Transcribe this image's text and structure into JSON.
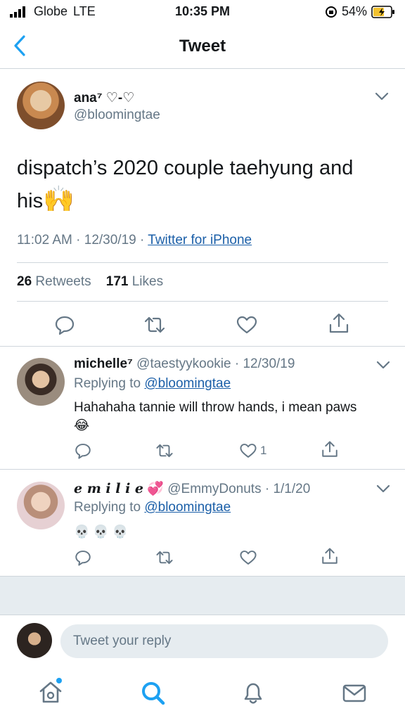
{
  "status_bar": {
    "carrier": "Globe",
    "network": "LTE",
    "time": "10:35 PM",
    "battery": "54%"
  },
  "header": {
    "title": "Tweet",
    "back_icon": "chevron-left-icon"
  },
  "tweet": {
    "display_name": "ana⁷ ♡-♡",
    "handle": "@bloomingtae",
    "text_line1": "dispatch’s 2020 couple taehyung and",
    "text_line2": "his",
    "emoji": "🙌",
    "time_date": "11:02 AM · 12/30/19 · ",
    "source": "Twitter for iPhone",
    "retweets_count": "26",
    "retweets_label": "Retweets",
    "likes_count": "171",
    "likes_label": "Likes"
  },
  "replies": [
    {
      "display_name": "michelle⁷",
      "handle": "@taestyykookie",
      "date": " · 12/30/19",
      "replying_prefix": "Replying to ",
      "replying_to": "@bloomingtae",
      "text": "Hahahaha tannie will throw hands, i mean paws",
      "emoji": "😂",
      "like_count": "1"
    },
    {
      "display_name": "𝒆 𝒎 𝒊 𝒍 𝒊 𝒆",
      "name_emoji": "💞",
      "handle": "@EmmyDonuts",
      "date": " · 1/1/20",
      "replying_prefix": "Replying to ",
      "replying_to": "@bloomingtae",
      "text": "💀 💀 💀",
      "like_count": ""
    }
  ],
  "compose": {
    "placeholder": "Tweet your reply"
  },
  "tabs": [
    "home-icon",
    "search-icon",
    "notifications-icon",
    "messages-icon"
  ],
  "colors": {
    "accent": "#1da1f2",
    "link": "#1b5fa8",
    "muted": "#657786"
  }
}
